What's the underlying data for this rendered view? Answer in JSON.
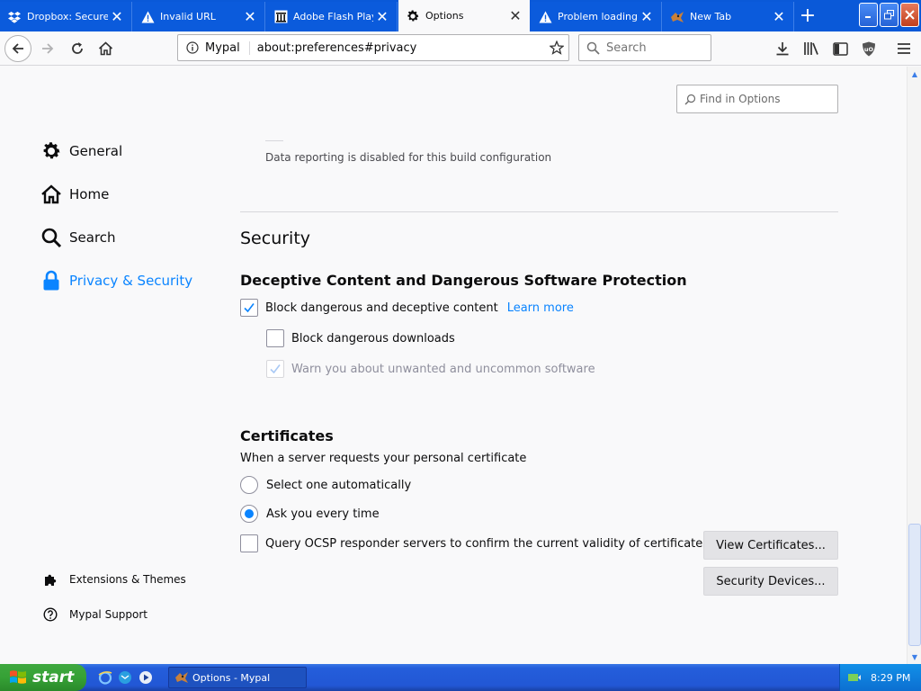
{
  "tabs": [
    {
      "label": "Dropbox: Secure",
      "icon": "dropbox-icon",
      "active": false
    },
    {
      "label": "Invalid URL",
      "icon": "warning-icon",
      "active": false
    },
    {
      "label": "Adobe Flash Playe",
      "icon": "museum-icon",
      "active": false
    },
    {
      "label": "Options",
      "icon": "gear-icon",
      "active": true
    },
    {
      "label": "Problem loading pa",
      "icon": "warning-icon",
      "active": false
    },
    {
      "label": "New Tab",
      "icon": "mypal-icon",
      "active": false
    }
  ],
  "navbar": {
    "site_name": "Mypal",
    "url": "about:preferences#privacy",
    "search_placeholder": "Search"
  },
  "find": {
    "placeholder": "Find in Options"
  },
  "sidebar": {
    "items": [
      {
        "label": "General",
        "icon": "gear-icon",
        "selected": false
      },
      {
        "label": "Home",
        "icon": "home-icon",
        "selected": false
      },
      {
        "label": "Search",
        "icon": "search-icon",
        "selected": false
      },
      {
        "label": "Privacy & Security",
        "icon": "lock-icon",
        "selected": true
      }
    ],
    "footer": [
      {
        "label": "Extensions & Themes",
        "icon": "puzzle-icon"
      },
      {
        "label": "Mypal Support",
        "icon": "help-icon"
      }
    ]
  },
  "main": {
    "data_note": "Data reporting is disabled for this build configuration",
    "security_heading": "Security",
    "deceptive": {
      "heading": "Deceptive Content and Dangerous Software Protection",
      "block_deceptive": {
        "label": "Block dangerous and deceptive content",
        "checked": true
      },
      "learn_more": "Learn more",
      "block_downloads": {
        "label": "Block dangerous downloads",
        "checked": false
      },
      "warn_unwanted": {
        "label": "Warn you about unwanted and uncommon software",
        "checked": true,
        "disabled": true
      }
    },
    "certificates": {
      "heading": "Certificates",
      "note": "When a server requests your personal certificate",
      "select_auto": {
        "label": "Select one automatically",
        "selected": false
      },
      "ask_every": {
        "label": "Ask you every time",
        "selected": true
      },
      "ocsp": {
        "label": "Query OCSP responder servers to confirm the current validity of certificates",
        "checked": false
      },
      "view_certs": "View Certificates...",
      "security_devices": "Security Devices..."
    }
  },
  "taskbar": {
    "start": "start",
    "task_label": "Options - Mypal",
    "clock": "8:29 PM"
  },
  "colors": {
    "accent": "#0a84ff",
    "tabstrip": "#0a59d8",
    "page_bg": "#f9f9fa"
  }
}
